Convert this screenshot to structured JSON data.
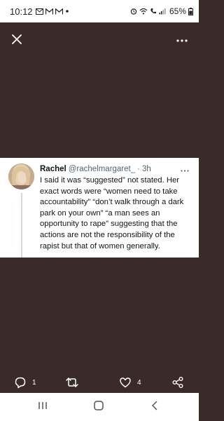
{
  "status_bar": {
    "time": "10:12",
    "battery_percent": "65%",
    "icons_left": [
      "mail-icon",
      "gmail-icon",
      "gmail-icon",
      "dot-icon"
    ],
    "icons_right": [
      "alarm-icon",
      "wifi-icon",
      "call-icon",
      "signal-icon",
      "battery-icon"
    ]
  },
  "media_viewer": {
    "close_icon": "close-icon",
    "more_icon": "more-horizontal-icon",
    "background_color": "#3a2a28"
  },
  "tweet": {
    "display_name": "Rachel",
    "handle": "@rachelmargaret_",
    "separator": "·",
    "time": "3h",
    "text": "I said it was “suggested” not stated. Her exact words were “women need to take accountability” “don’t walk through a dark park on your own” “a man sees an opportunity to rape” suggesting that the actions are not the responsibility of the rapist but that of women generally."
  },
  "actions": {
    "reply_count": "1",
    "retweet_count": "",
    "like_count": "4"
  },
  "nav": {
    "icons": [
      "recent-apps-icon",
      "home-icon",
      "back-icon"
    ]
  }
}
